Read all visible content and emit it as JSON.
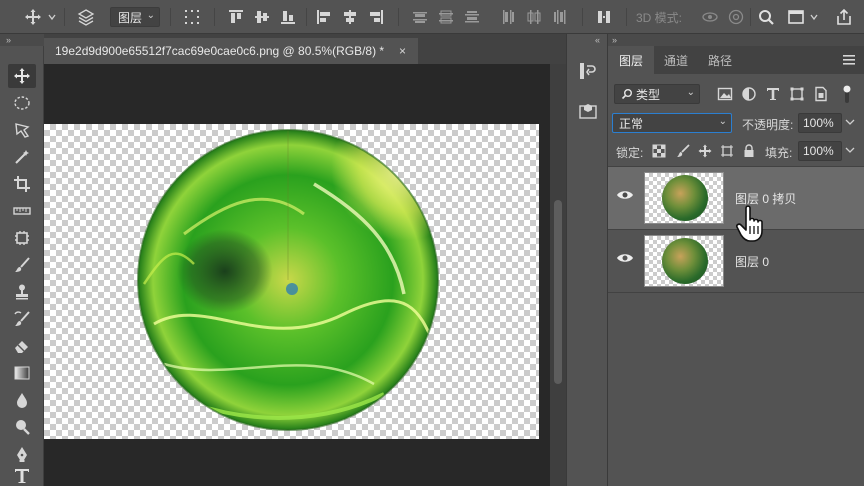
{
  "toolbar": {
    "layer_target": "图层",
    "mode_3d": "3D 模式:"
  },
  "document": {
    "tab_title": "19e2d9d900e65512f7cac69e0cae0c6.png @ 80.5%(RGB/8) *",
    "close_glyph": "×"
  },
  "panel": {
    "tabs": [
      {
        "label": "图层"
      },
      {
        "label": "通道"
      },
      {
        "label": "路径"
      }
    ],
    "filter_kind": "类型",
    "blend_mode": "正常",
    "opacity_label": "不透明度:",
    "opacity_value": "100%",
    "lock_label": "锁定:",
    "fill_label": "填充:",
    "fill_value": "100%",
    "layers": [
      {
        "name": "图层 0 拷贝"
      },
      {
        "name": "图层 0"
      }
    ]
  },
  "colors": {
    "ui_bg": "#535353",
    "canvas_bg": "#282828",
    "selected_layer": "#6b6b6b",
    "accent_blue": "#2b7fd1"
  }
}
